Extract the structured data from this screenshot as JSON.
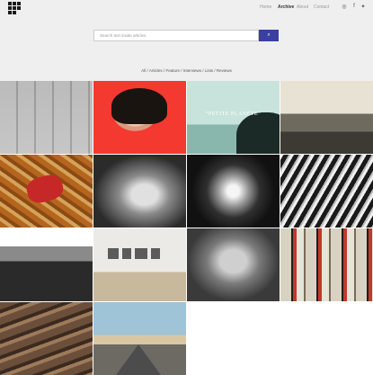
{
  "nav": {
    "items": [
      {
        "label": "Home",
        "active": false
      },
      {
        "label": "Archive",
        "active": true
      },
      {
        "label": "About",
        "active": false
      },
      {
        "label": "Contact",
        "active": false
      }
    ],
    "social": [
      "instagram-icon",
      "facebook-icon",
      "twitter-icon"
    ]
  },
  "search": {
    "placeholder": "Search text inside articles",
    "button_icon": "search-icon"
  },
  "filters": {
    "items": [
      "All",
      "Articles",
      "Feature",
      "Interviews",
      "Lists",
      "Reviews"
    ],
    "separator": "/"
  },
  "tiles": {
    "t3_title": "“PETITE PLANÈTE”"
  },
  "colors": {
    "accent": "#3b3fa0",
    "header_bg": "#efefef"
  }
}
